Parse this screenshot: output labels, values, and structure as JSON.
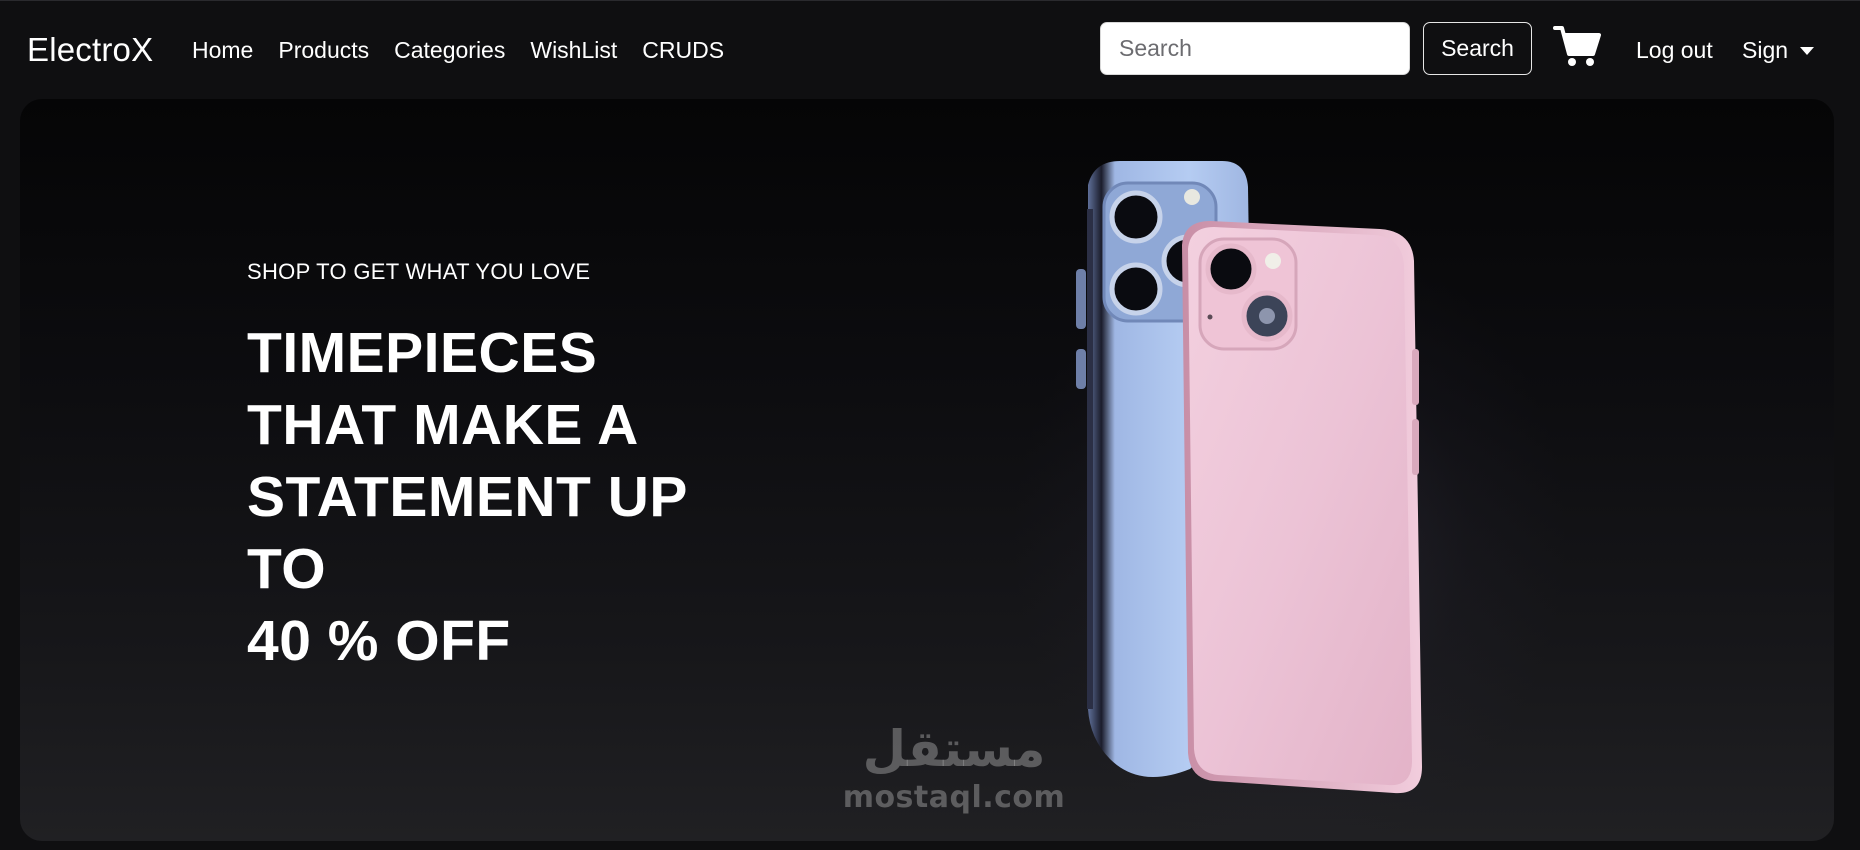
{
  "header": {
    "brand": "ElectroX",
    "nav": [
      {
        "label": "Home"
      },
      {
        "label": "Products"
      },
      {
        "label": "Categories"
      },
      {
        "label": "WishList"
      },
      {
        "label": "CRUDS"
      }
    ],
    "search": {
      "placeholder": "Search",
      "value": "",
      "button_label": "Search"
    },
    "cart_icon": "shopping-cart-icon",
    "logout_label": "Log out",
    "sign_label": "Sign"
  },
  "hero": {
    "eyebrow": "SHOP TO GET WHAT YOU LOVE",
    "headline_lines": [
      "TIMEPIECES",
      "THAT MAKE A",
      "STATEMENT UP",
      "TO",
      "40 % OFF"
    ],
    "image": "two-iphones-blue-and-pink"
  },
  "watermark": {
    "arabic": "مستقل",
    "latin": "mostaql.com"
  },
  "colors": {
    "background": "#0f0f11",
    "text": "#ffffff",
    "phone_blue": "#a9c4ec",
    "phone_pink": "#efc6d8"
  }
}
